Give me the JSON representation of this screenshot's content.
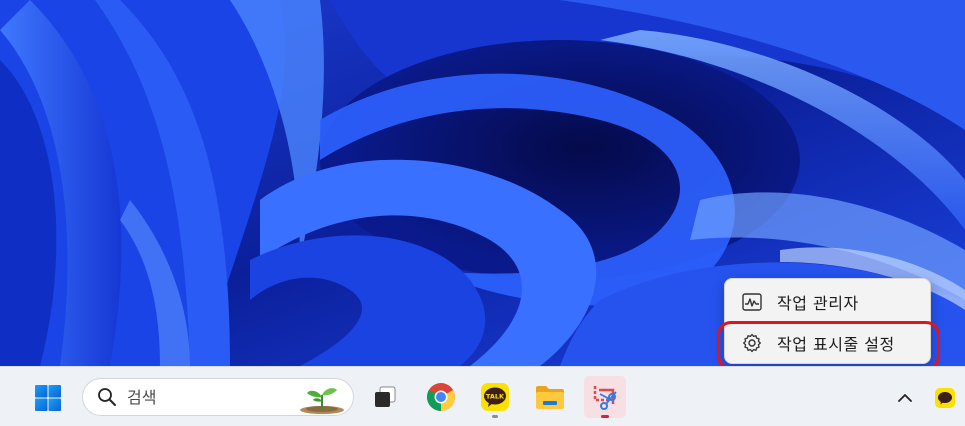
{
  "context_menu": {
    "items": [
      {
        "label": "작업 관리자",
        "icon": "task-manager-icon"
      },
      {
        "label": "작업 표시줄 설정",
        "icon": "gear-icon"
      }
    ],
    "highlighted_item_index": 1,
    "highlight_color": "#e0151b"
  },
  "taskbar": {
    "search": {
      "placeholder": "검색",
      "icon": "search-icon"
    },
    "apps": [
      {
        "name": "task-view",
        "icon": "task-view-icon",
        "running": false
      },
      {
        "name": "chrome",
        "icon": "chrome-icon",
        "running": false
      },
      {
        "name": "kakaotalk",
        "icon": "kakaotalk-icon",
        "badge_text": "TALK",
        "running": true
      },
      {
        "name": "file-explorer",
        "icon": "folder-icon",
        "running": false
      },
      {
        "name": "snipping-tool",
        "icon": "snipping-tool-icon",
        "running": true,
        "active": true
      }
    ],
    "tray": {
      "chevron_icon": "chevron-up-icon",
      "kakao_tray_icon": "kakao-chat-icon"
    }
  },
  "colors": {
    "taskbar_bg": "#eef1f6",
    "menu_bg": "#f3f3f3",
    "wallpaper_blue": "#1a3fe0",
    "kakao_yellow": "#fae100"
  }
}
